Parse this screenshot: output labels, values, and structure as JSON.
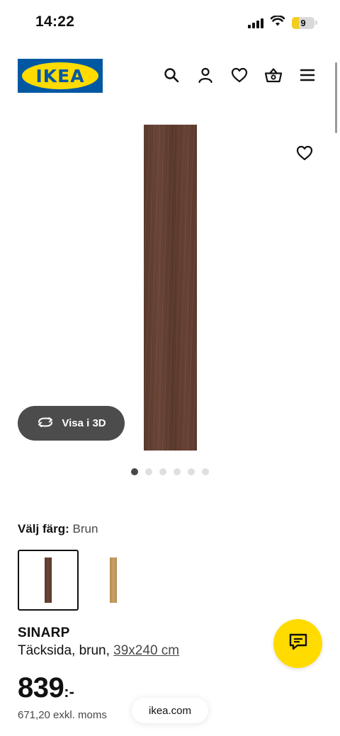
{
  "status_bar": {
    "time": "14:22",
    "battery_level": "9"
  },
  "header": {
    "logo_text": "IKEA",
    "icons": [
      "search-icon",
      "account-icon",
      "heart-icon",
      "basket-icon",
      "menu-icon"
    ]
  },
  "gallery": {
    "view_3d_label": "Visa i 3D",
    "image_count": 6,
    "active_image": 1
  },
  "color_picker": {
    "label": "Välj färg:",
    "selected_value": "Brun",
    "swatches": [
      {
        "name": "brun",
        "color": "#5b3a2e",
        "selected": true
      },
      {
        "name": "ek",
        "color": "#c4975c",
        "selected": false
      }
    ]
  },
  "product": {
    "name": "SINARP",
    "description": "Täcksida, brun, ",
    "size": "39x240 cm",
    "price": "839",
    "price_suffix": ":-",
    "price_ex_vat": "671,20 exkl. moms"
  },
  "browser": {
    "url": "ikea.com"
  },
  "colors": {
    "ikea_blue": "#0058a3",
    "ikea_yellow": "#ffdb00",
    "button_dark": "#4c4c4c"
  }
}
